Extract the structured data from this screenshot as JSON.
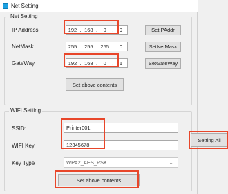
{
  "window": {
    "title": "Net Setting"
  },
  "net": {
    "group_title": "Net Setting",
    "ip_label": "IP Address:",
    "ip": [
      "192",
      "168",
      "0",
      "9"
    ],
    "netmask_label": "NetMask",
    "netmask": [
      "255",
      "255",
      "255",
      "0"
    ],
    "gateway_label": "GateWay",
    "gateway": [
      "192",
      "168",
      "0",
      "1"
    ],
    "set_ip_btn": "SetIPAddr",
    "set_netmask_btn": "SetNetMask",
    "set_gateway_btn": "SetGateWay",
    "set_above_btn": "Set above contents"
  },
  "wifi": {
    "group_title": "WIFI Setting",
    "ssid_label": "SSID:",
    "ssid_value": "Printer001",
    "key_label": "WIFI Key",
    "key_value": "12345678",
    "keytype_label": "Key Type",
    "keytype_value": "WPA2_AES_PSK",
    "set_above_btn": "Set above contents"
  },
  "setting_all_btn": "Setting All",
  "colors": {
    "highlight": "#e8462a",
    "app_icon": "#1ba1e2"
  }
}
